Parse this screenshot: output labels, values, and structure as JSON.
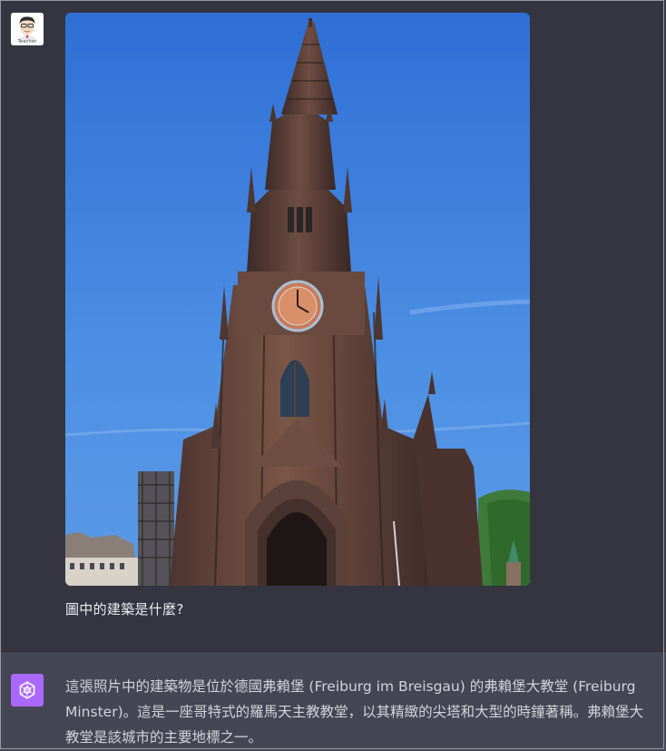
{
  "user_message": {
    "avatar_caption": "Teacher",
    "avatar_icon": "teacher-avatar-icon",
    "image_alt": "Freiburg Minster tower photo",
    "prompt": "圖中的建築是什麼?"
  },
  "assistant_message": {
    "avatar_icon": "openai-logo-icon",
    "text": "這張照片中的建築物是位於德國弗賴堡 (Freiburg im Breisgau) 的弗賴堡大教堂 (Freiburg Minster)。這是一座哥特式的羅馬天主教教堂，以其精緻的尖塔和大型的時鐘著稱。弗賴堡大教堂是該城市的主要地標之一。"
  },
  "colors": {
    "page_bg": "#343541",
    "assistant_bg": "#444654",
    "bot_avatar": "#ab68ff",
    "sky": "#3a7fd8",
    "stone": "#6b4a3e"
  }
}
